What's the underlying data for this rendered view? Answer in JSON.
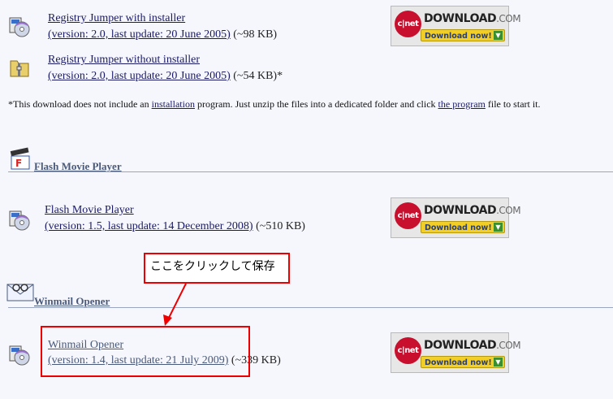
{
  "items": [
    {
      "title": "Registry Jumper with installer",
      "version": "(version: 2.0, last update: 20 June 2005)",
      "size": " (~98 KB)"
    },
    {
      "title": "Registry Jumper without installer",
      "version": "(version: 2.0, last update: 20 June 2005)",
      "size": " (~54 KB)*"
    },
    {
      "title": "Flash Movie Player",
      "version": "(version: 1.5, last update: 14 December 2008)",
      "size": " (~510 KB)"
    },
    {
      "title": "Winmail Opener",
      "version": "(version: 1.4, last update: 21 July 2009)",
      "size": " (~339 KB)"
    }
  ],
  "note": {
    "part1": "*This download does not include an ",
    "link1": "installation",
    "part2": " program. Just unzip the files into a dedicated folder and click ",
    "link2": "the program",
    "part3": " file to start it."
  },
  "sections": [
    {
      "title": "Flash Movie Player"
    },
    {
      "title": "Winmail Opener"
    }
  ],
  "badge": {
    "logo": "c|net",
    "brand": "DOWNLOAD",
    "brand_suffix": ".COM",
    "button": "Download now!",
    "arrow": "▼"
  },
  "annotation": {
    "text": "ここをクリックして保存"
  }
}
